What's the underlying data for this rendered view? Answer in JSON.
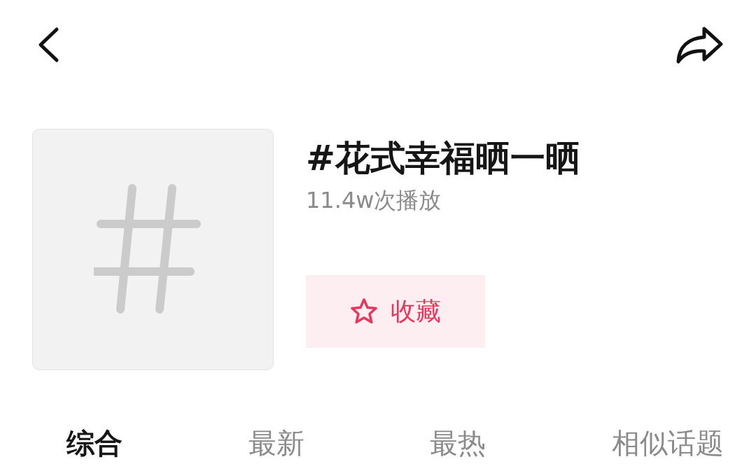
{
  "topic": {
    "title": "#花式幸福晒一晒",
    "plays": "11.4w次播放"
  },
  "favorite_button": {
    "label": "收藏",
    "favorited": false
  },
  "tabs": [
    {
      "label": "综合",
      "selected": true
    },
    {
      "label": "最新",
      "selected": false
    },
    {
      "label": "最热",
      "selected": false
    },
    {
      "label": "相似话题",
      "selected": false
    }
  ]
}
